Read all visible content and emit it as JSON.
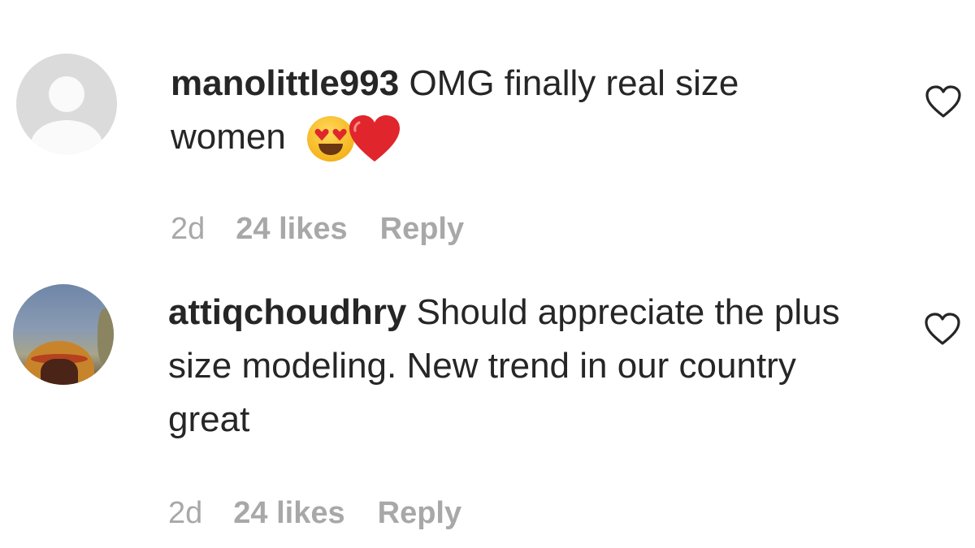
{
  "comments": [
    {
      "username": "manolittle993",
      "text": "OMG finally real size women",
      "emoji_names": [
        "heart-eyes-emoji",
        "red-heart-emoji"
      ],
      "avatar": "default-avatar",
      "time": "2d",
      "likes": "24 likes",
      "reply_label": "Reply",
      "like_icon": "heart-outline-icon"
    },
    {
      "username": "attiqchoudhry",
      "text": "Should appreciate the plus size modeling. New trend in our country great",
      "avatar": "profile-photo",
      "time": "2d",
      "likes": "24 likes",
      "reply_label": "Reply",
      "like_icon": "heart-outline-icon"
    }
  ],
  "colors": {
    "text_primary": "#262626",
    "text_secondary": "#a8a8a8",
    "heart_red": "#e0262c",
    "background": "#ffffff"
  }
}
